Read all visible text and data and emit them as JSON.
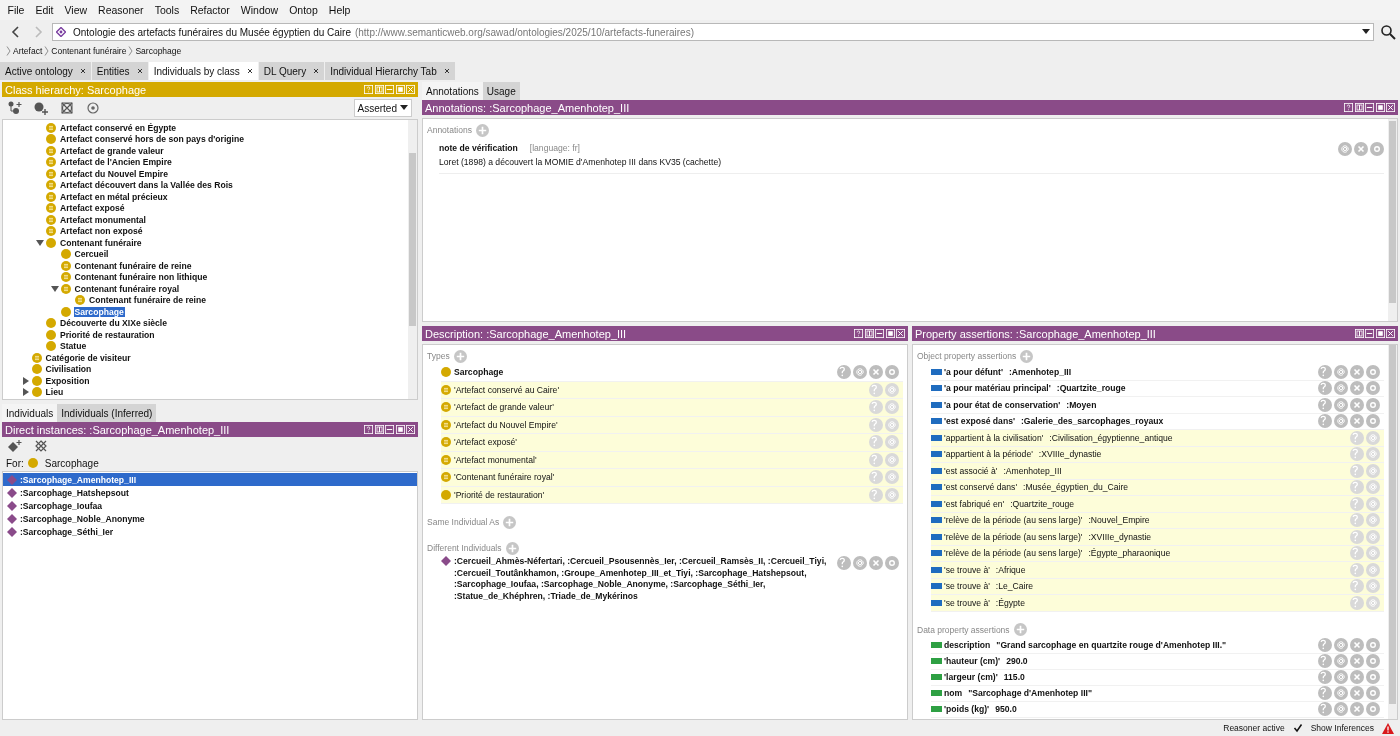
{
  "menu": [
    "File",
    "Edit",
    "View",
    "Reasoner",
    "Tools",
    "Refactor",
    "Window",
    "Ontop",
    "Help"
  ],
  "address": {
    "title": "Ontologie des artefacts funéraires du Musée égyptien du Caire",
    "iri": "(http://www.semanticweb.org/sawad/ontologies/2025/10/artefacts-funeraires)"
  },
  "breadcrumb": [
    "Artefact",
    "Contenant funéraire",
    "Sarcophage"
  ],
  "tabs": [
    {
      "label": "Active ontology",
      "selected": false
    },
    {
      "label": "Entities",
      "selected": false
    },
    {
      "label": "Individuals by class",
      "selected": true
    },
    {
      "label": "DL Query",
      "selected": false
    },
    {
      "label": "Individual Hierarchy Tab",
      "selected": false
    }
  ],
  "class_hierarchy": {
    "title": "Class hierarchy: Sarcophage",
    "mode": "Asserted",
    "branch_children": [
      {
        "label": "Artefact conservé en Égypte",
        "kind": "defined",
        "selected": false
      },
      {
        "label": "Artefact conservé hors de son pays d'origine",
        "kind": "primitive",
        "selected": false
      },
      {
        "label": "Artefact de grande valeur",
        "kind": "defined",
        "selected": false
      },
      {
        "label": "Artefact de l'Ancien Empire",
        "kind": "defined",
        "selected": false
      },
      {
        "label": "Artefact du Nouvel Empire",
        "kind": "defined",
        "selected": false
      },
      {
        "label": "Artefact découvert dans la Vallée des Rois",
        "kind": "defined",
        "selected": false
      },
      {
        "label": "Artefact en métal précieux",
        "kind": "defined",
        "selected": false
      },
      {
        "label": "Artefact exposé",
        "kind": "defined",
        "selected": false
      },
      {
        "label": "Artefact monumental",
        "kind": "defined",
        "selected": false
      },
      {
        "label": "Artefact non exposé",
        "kind": "defined",
        "selected": false
      },
      {
        "label": "Contenant funéraire",
        "kind": "primitive",
        "selected": false,
        "expanded": true,
        "children": [
          {
            "label": "Cercueil",
            "kind": "primitive",
            "selected": false
          },
          {
            "label": "Contenant funéraire de reine",
            "kind": "defined",
            "selected": false
          },
          {
            "label": "Contenant funéraire non lithique",
            "kind": "defined",
            "selected": false
          },
          {
            "label": "Contenant funéraire royal",
            "kind": "defined",
            "selected": false,
            "expanded": true,
            "children": [
              {
                "label": "Contenant funéraire de reine",
                "kind": "defined",
                "selected": false
              }
            ]
          },
          {
            "label": "Sarcophage",
            "kind": "primitive",
            "selected": true
          }
        ]
      },
      {
        "label": "Découverte du XIXe siècle",
        "kind": "primitive",
        "selected": false
      },
      {
        "label": "Priorité de restauration",
        "kind": "primitive",
        "selected": false
      },
      {
        "label": "Statue",
        "kind": "primitive",
        "selected": false
      }
    ],
    "items": [
      {
        "label": "Catégorie de visiteur",
        "kind": "defined",
        "selected": false
      },
      {
        "label": "Civilisation",
        "kind": "primitive",
        "selected": false
      },
      {
        "label": "Exposition",
        "kind": "primitive",
        "selected": false,
        "expanded": false
      },
      {
        "label": "Lieu",
        "kind": "primitive",
        "selected": false,
        "expanded": false
      }
    ]
  },
  "individuals_tabs": [
    {
      "label": "Individuals",
      "selected": true
    },
    {
      "label": "Individuals (Inferred)",
      "selected": false
    }
  ],
  "direct_instances": {
    "title": "Direct instances: :Sarcophage_Amenhotep_III",
    "for_label": "For:",
    "for_class": "Sarcophage",
    "items": [
      {
        "label": ":Sarcophage_Amenhotep_III",
        "selected": true
      },
      {
        "label": ":Sarcophage_Hatshepsout",
        "selected": false
      },
      {
        "label": ":Sarcophage_Ioufaa",
        "selected": false
      },
      {
        "label": ":Sarcophage_Noble_Anonyme",
        "selected": false
      },
      {
        "label": ":Sarcophage_Séthi_Ier",
        "selected": false
      }
    ]
  },
  "annotation_tabs": [
    {
      "label": "Annotations",
      "selected": true
    },
    {
      "label": "Usage",
      "selected": false
    }
  ],
  "annotations": {
    "title": "Annotations: :Sarcophage_Amenhotep_III",
    "heading": "Annotations",
    "items": [
      {
        "property": "note de vérification",
        "language": "[language: fr]",
        "value": "Loret (1898) a découvert la MOMIE d'Amenhotep III dans KV35 (cachette)"
      }
    ]
  },
  "description": {
    "title": "Description: :Sarcophage_Amenhotep_III",
    "types_heading": "Types",
    "types": [
      {
        "label": "Sarcophage",
        "kind": "primitive",
        "inferred": false
      },
      {
        "label": "'Artefact conservé au Caire'",
        "kind": "defined",
        "inferred": true
      },
      {
        "label": "'Artefact de grande valeur'",
        "kind": "defined",
        "inferred": true
      },
      {
        "label": "'Artefact du Nouvel Empire'",
        "kind": "defined",
        "inferred": true
      },
      {
        "label": "'Artefact exposé'",
        "kind": "defined",
        "inferred": true
      },
      {
        "label": "'Artefact monumental'",
        "kind": "defined",
        "inferred": true
      },
      {
        "label": "'Contenant funéraire royal'",
        "kind": "defined",
        "inferred": true
      },
      {
        "label": "'Priorité de restauration'",
        "kind": "primitive",
        "inferred": true
      }
    ],
    "same_heading": "Same Individual As",
    "different_heading": "Different Individuals",
    "different": [
      ":Cercueil_Ahmès-Néfertari, :Cercueil_Psousennès_Ier, :Cercueil_Ramsès_II, :Cercueil_Tiyi, :Cercueil_Toutânkhamon, :Groupe_Amenhotep_III_et_Tiyi, :Sarcophage_Hatshepsout, :Sarcophage_Ioufaa, :Sarcophage_Noble_Anonyme, :Sarcophage_Séthi_Ier, :Statue_de_Khéphren, :Triade_de_Mykérinos"
    ]
  },
  "property_assertions": {
    "title": "Property assertions: :Sarcophage_Amenhotep_III",
    "object_heading": "Object property assertions",
    "object": [
      {
        "property": "'a pour défunt'",
        "value": ":Amenhotep_III",
        "inferred": false
      },
      {
        "property": "'a pour matériau principal'",
        "value": ":Quartzite_rouge",
        "inferred": false
      },
      {
        "property": "'a pour état de conservation'",
        "value": ":Moyen",
        "inferred": false
      },
      {
        "property": "'est exposé dans'",
        "value": ":Galerie_des_sarcophages_royaux",
        "inferred": false
      },
      {
        "property": "'appartient à la civilisation'",
        "value": ":Civilisation_égyptienne_antique",
        "inferred": true
      },
      {
        "property": "'appartient à la période'",
        "value": ":XVIIIe_dynastie",
        "inferred": true
      },
      {
        "property": "'est associé à'",
        "value": ":Amenhotep_III",
        "inferred": true
      },
      {
        "property": "'est conservé dans'",
        "value": ":Musée_égyptien_du_Caire",
        "inferred": true
      },
      {
        "property": "'est fabriqué en'",
        "value": ":Quartzite_rouge",
        "inferred": true
      },
      {
        "property": "'relève de la période (au sens large)'",
        "value": ":Nouvel_Empire",
        "inferred": true
      },
      {
        "property": "'relève de la période (au sens large)'",
        "value": ":XVIIIe_dynastie",
        "inferred": true
      },
      {
        "property": "'relève de la période (au sens large)'",
        "value": ":Égypte_pharaonique",
        "inferred": true
      },
      {
        "property": "'se trouve à'",
        "value": ":Afrique",
        "inferred": true
      },
      {
        "property": "'se trouve à'",
        "value": ":Le_Caire",
        "inferred": true
      },
      {
        "property": "'se trouve à'",
        "value": ":Égypte",
        "inferred": true
      }
    ],
    "data_heading": "Data property assertions",
    "data": [
      {
        "property": "description",
        "value": "\"Grand sarcophage en quartzite rouge d'Amenhotep III.\"",
        "inferred": false
      },
      {
        "property": "'hauteur (cm)'",
        "value": "290.0",
        "inferred": false
      },
      {
        "property": "'largeur (cm)'",
        "value": "115.0",
        "inferred": false
      },
      {
        "property": "nom",
        "value": "\"Sarcophage d'Amenhotep III\"",
        "inferred": false
      },
      {
        "property": "'poids (kg)'",
        "value": "950.0",
        "inferred": false
      }
    ]
  },
  "status": {
    "reasoner": "Reasoner active",
    "show_inferences": {
      "label": "Show Inferences",
      "checked": true
    }
  }
}
